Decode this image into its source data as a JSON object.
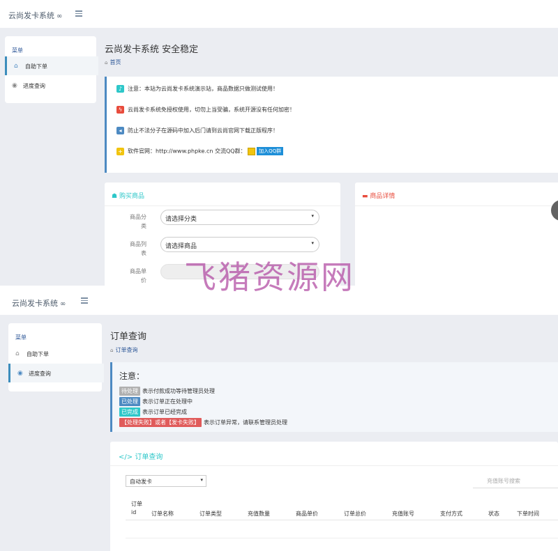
{
  "top": {
    "brand": "云尚发卡系统",
    "sidebar": {
      "menu_title": "菜单",
      "items": [
        {
          "label": "自助下单",
          "icon": "home-icon"
        },
        {
          "label": "进度查询",
          "icon": "eye-icon"
        }
      ]
    },
    "page_title": "云尚发卡系统 安全稳定",
    "breadcrumb": "首页",
    "notices": [
      {
        "text": "注意：本站为云尚发卡系统演示站，商品数据只做测试使用！",
        "icon": "bell-icon",
        "color": "#2ec7c9"
      },
      {
        "text": "云尚发卡系统免授权使用，切勿上当受骗，系统开源没有任何加密！",
        "icon": "bolt-icon",
        "color": "#e84c3d"
      },
      {
        "text": "防止不法分子在源码中加入后门请到云尚官网下载正版程序！",
        "icon": "megaphone-icon",
        "color": "#4d8ac2"
      },
      {
        "text": "软件官网：http://www.phpke.cn    交流QQ群：",
        "icon": "plus-icon",
        "color": "#f1c40f",
        "qq_button": "加入QQ群"
      }
    ],
    "buy_panel": {
      "title": "购买商品",
      "fields": [
        {
          "label": "商品分类",
          "value": "请选择分类"
        },
        {
          "label": "商品列表",
          "value": "请选择商品"
        },
        {
          "label": "商品单价",
          "value": ""
        }
      ]
    },
    "detail_panel": {
      "title": "商品详情"
    }
  },
  "watermark": "飞猪资源网",
  "bottom": {
    "brand": "云尚发卡系统",
    "sidebar": {
      "menu_title": "菜单",
      "items": [
        {
          "label": "自助下单",
          "icon": "home-icon"
        },
        {
          "label": "进度查询",
          "icon": "eye-icon"
        }
      ]
    },
    "page_title": "订单查询",
    "breadcrumb": "订单查询",
    "notice_title": "注意：",
    "statuses": [
      {
        "tag": "待处理",
        "desc": "表示付款成功等待管理员处理",
        "color": "#b0b0b0"
      },
      {
        "tag": "已处理",
        "desc": "表示订单正在处理中",
        "color": "#4d8ac2"
      },
      {
        "tag": "已完成",
        "desc": "表示订单已经完成",
        "color": "#2ec7c9"
      },
      {
        "tag": "【处理失败】或者【发卡失败】",
        "desc": "表示订单异常，请联系管理员处理",
        "color": "#e05b5b"
      }
    ],
    "order_panel": {
      "title": "订单查询",
      "type_select": "自动发卡",
      "search_placeholder": "充值账号搜索",
      "columns": [
        "订单id",
        "订单名称",
        "订单类型",
        "充值数量",
        "商品单价",
        "订单总价",
        "充值账号",
        "支付方式",
        "状态",
        "下单时间"
      ]
    }
  }
}
